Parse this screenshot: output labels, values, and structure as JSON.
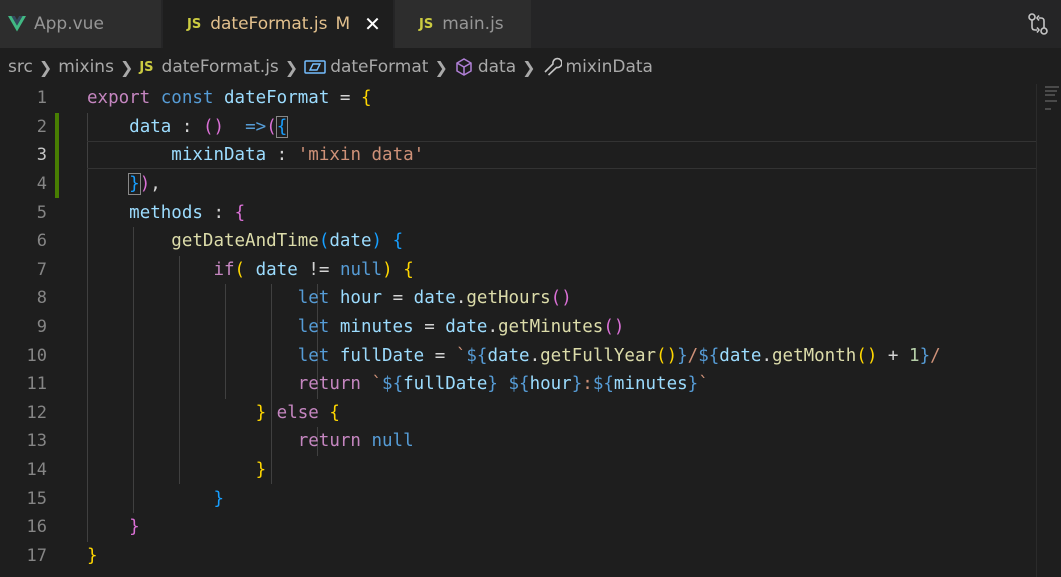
{
  "tabs": [
    {
      "label": "App.vue",
      "icon": "vue-icon",
      "active": false
    },
    {
      "label": "dateFormat.js",
      "icon": "js-icon",
      "active": true,
      "modified": "M"
    },
    {
      "label": "main.js",
      "icon": "js-icon",
      "active": false
    }
  ],
  "js_badge": "JS",
  "breadcrumb": {
    "items": [
      "src",
      "mixins",
      "dateFormat.js",
      "dateFormat",
      "data",
      "mixinData"
    ]
  },
  "editor": {
    "current_line": 3,
    "line_numbers": [
      "1",
      "2",
      "3",
      "4",
      "5",
      "6",
      "7",
      "8",
      "9",
      "10",
      "11",
      "12",
      "13",
      "14",
      "15",
      "16",
      "17"
    ],
    "lines": [
      "export const dateFormat = {",
      "    data : ()  =>({",
      "        mixinData : 'mixin data'",
      "    }),",
      "    methods : {",
      "        getDateAndTime(date) {",
      "            if( date != null) {",
      "                    let hour = date.getHours()",
      "                    let minutes = date.getMinutes()",
      "                    let fullDate = `${date.getFullYear()}/${date.getMonth() + 1}/",
      "                    return `${fullDate} ${hour}:${minutes}`",
      "                } else {",
      "                    return null",
      "                }",
      "            }",
      "    }",
      "}"
    ]
  },
  "colors": {
    "keyword": "#c586c0",
    "storage": "#569cd6",
    "variable": "#9cdcfe",
    "function": "#dcdcaa",
    "string": "#ce9178",
    "modified_file": "#e2c08d",
    "gutter_modified": "#487e02"
  }
}
